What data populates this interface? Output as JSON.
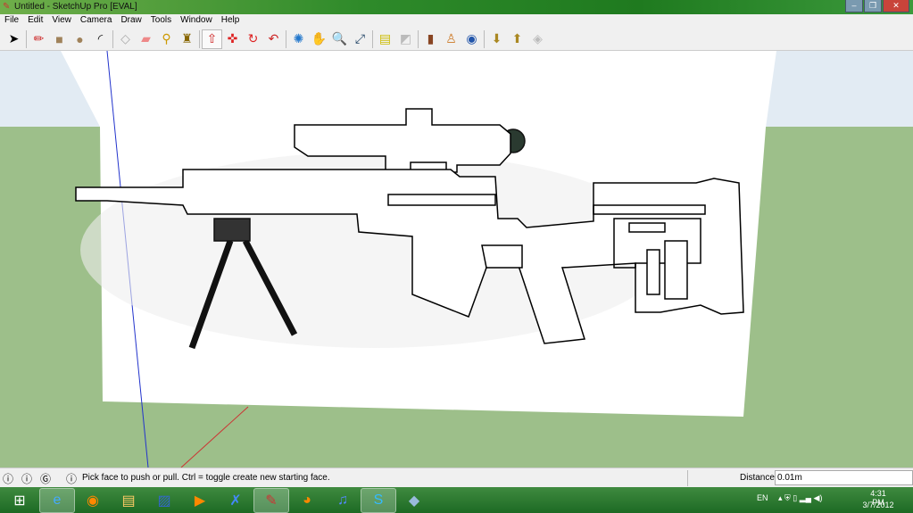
{
  "window": {
    "title": "Untitled - SketchUp Pro [EVAL]"
  },
  "menu": [
    "File",
    "Edit",
    "View",
    "Camera",
    "Draw",
    "Tools",
    "Window",
    "Help"
  ],
  "toolbar": [
    "select-icon",
    "pencil-icon",
    "rectangle-icon",
    "circle-icon",
    "arc-icon",
    "make-component-icon",
    "eraser-icon",
    "tape-measure-icon",
    "paint-bucket-icon",
    "push-pull-icon",
    "move-icon",
    "rotate-icon",
    "follow-me-icon",
    "orbit-icon",
    "pan-icon",
    "zoom-icon",
    "zoom-extents-icon",
    "get-models-icon",
    "share-model-icon",
    "add-location-icon",
    "toggle-terrain-icon",
    "google-earth-icon",
    "get-component-icon",
    "share-component-icon",
    "extension-icon"
  ],
  "status": {
    "hint": "Pick face to push or pull.  Ctrl = toggle create new starting face.",
    "measure_label": "Distance",
    "measure_value": "0.01m"
  },
  "taskbar": {
    "language": "EN",
    "time": "4:31 PM",
    "date": "3/7/2012"
  }
}
